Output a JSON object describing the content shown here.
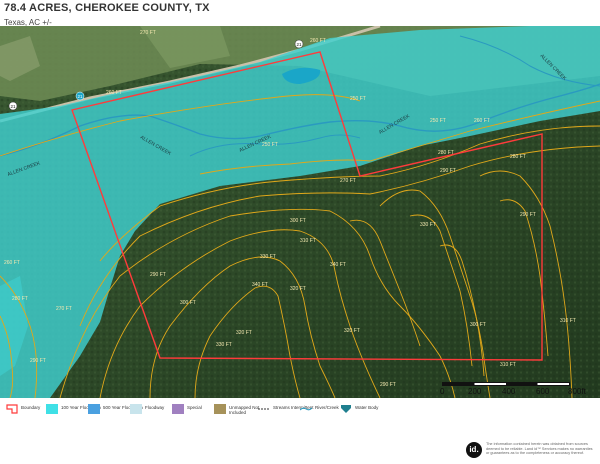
{
  "header": {
    "title": "78.4 ACRES, CHEROKEE COUNTY, TX",
    "subtitle": "Texas,  AC +/-"
  },
  "map": {
    "labels": {
      "road_marker_left": "21",
      "road_marker_top": "21",
      "road_marker_blue": "21",
      "creek_top_right": "ALLEN CREEK",
      "creek_center_a": "ALLEN CREEK",
      "creek_center_b": "ALLEN CREEK",
      "creek_mid_right": "ALLEN CREEK",
      "creek_left": "ALLEN CREEK",
      "contour_270_top": "270 FT",
      "contour_260_a": "260 FT",
      "contour_260_b": "260 FT",
      "contour_250_a": "250 FT",
      "contour_250_b": "250 FT",
      "contour_250_c": "250 FT",
      "contour_260_c": "260 FT",
      "contour_270_mid": "270 FT",
      "contour_280_a": "280 FT",
      "contour_290_a": "290 FT",
      "contour_300_a": "300 FT",
      "contour_310_a": "310 FT",
      "contour_320_a": "320 FT",
      "contour_330_a": "330 FT",
      "contour_340_a": "340 FT",
      "contour_320_b": "320 FT",
      "contour_300_b": "300 FT",
      "contour_290_b": "290 FT",
      "contour_280_left": "280 FT",
      "contour_260_left": "260 FT",
      "contour_270_left": "270 FT",
      "contour_290_left": "290 FT",
      "contour_280_right": "280 FT",
      "contour_290_right": "290 FT",
      "contour_310_right": "310 FT",
      "contour_290_bottom": "290 FT",
      "contour_300_bottom": "300 FT",
      "contour_310_bottom": "310 FT",
      "contour_330_bottom": "330 FT",
      "contour_320_bottom": "320 FT",
      "contour_330_b": "330 FT",
      "contour_340_b": "340 FT"
    },
    "colors": {
      "floodplain_100yr": "#3fd0d0",
      "boundary": "#ff3b3b",
      "contour": "#e0a81a",
      "forest": "#2f4a2a",
      "pasture": "#6f8f5a",
      "water": "#1aa6c8"
    }
  },
  "scale": {
    "labels": [
      "0",
      "200",
      "400",
      "600",
      "800ft"
    ]
  },
  "legend": {
    "items": [
      {
        "label": "Boundary",
        "color": "#ffffff",
        "icon": "boundary-icon"
      },
      {
        "label": "100 Year Floodplain",
        "color": "#3fe0e6"
      },
      {
        "label": "500 Year Floodplain",
        "color": "#4aa0e0"
      },
      {
        "label": "Floodway",
        "color": "#c8e4ec"
      },
      {
        "label": "Special",
        "color": "#a080c0"
      },
      {
        "label": "Unmapped Not Included",
        "color": "#a6925a"
      },
      {
        "label": "Streams Intermittent",
        "color": "#ffffff",
        "icon": "stream-intermittent-icon"
      },
      {
        "label": "River/Creek",
        "color": "#ffffff",
        "icon": "river-icon"
      },
      {
        "label": "Water Body",
        "color": "#1f7f8f",
        "icon": "water-body-icon"
      }
    ]
  },
  "footer": {
    "logo_text": "id.",
    "disclaimer": "The information contained herein was obtained from sources deemed to be reliable. Land id™ Services makes no warranties or guarantees as to the completeness or accuracy thereof."
  }
}
